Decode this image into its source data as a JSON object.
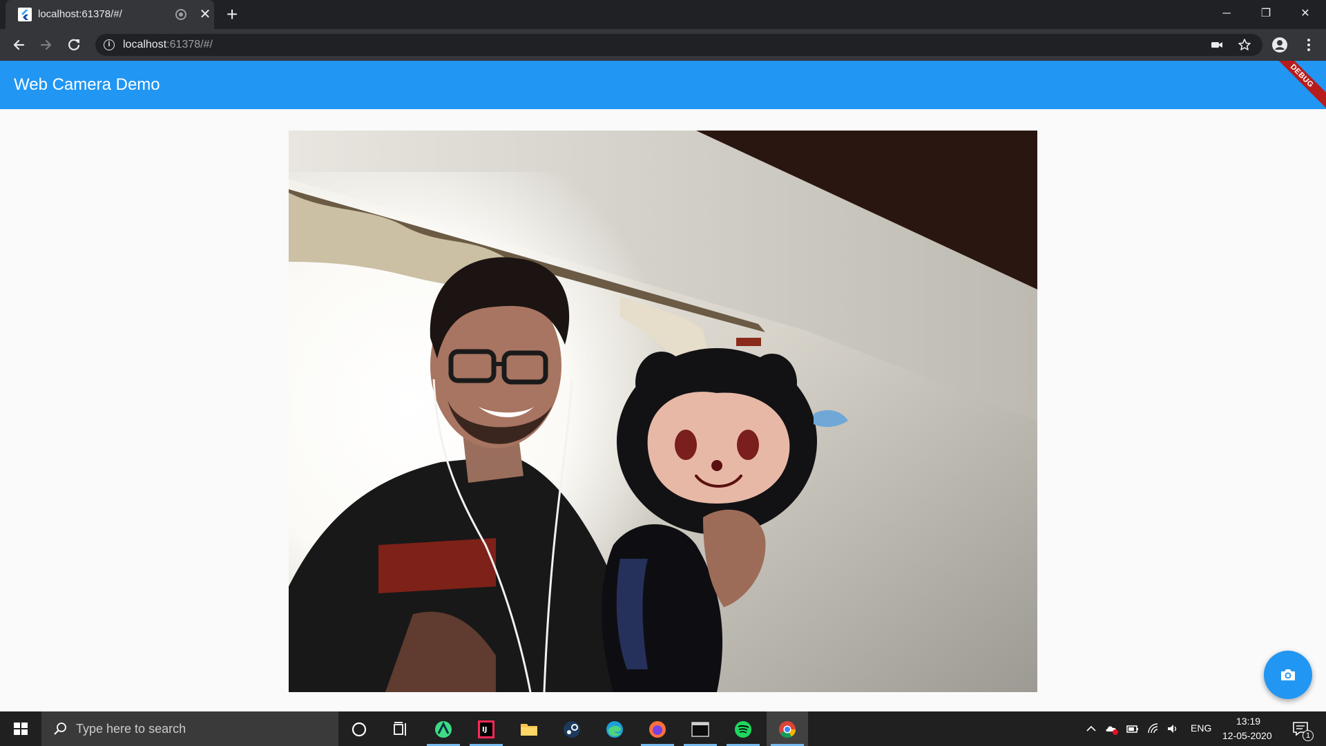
{
  "browser": {
    "tab_title": "localhost:61378/#/",
    "new_tab_label": "+",
    "close_tab_label": "✕",
    "url_host": "localhost",
    "url_path": ":61378/#/",
    "window_controls": {
      "minimize": "─",
      "restore": "❐",
      "close": "✕"
    }
  },
  "app": {
    "title": "Web Camera Demo",
    "debug_banner": "DEBUG",
    "camera_preview": "webcam-video-feed",
    "fab_icon": "camera-icon",
    "accent_color": "#2196f3"
  },
  "taskbar": {
    "search_placeholder": "Type here to search",
    "apps": [
      "cortana",
      "task-view",
      "android-studio",
      "intellij-idea",
      "file-explorer",
      "steam",
      "edge",
      "firefox",
      "terminal",
      "spotify",
      "chrome"
    ],
    "language": "ENG",
    "time": "13:19",
    "date": "12-05-2020",
    "notification_count": "1"
  }
}
